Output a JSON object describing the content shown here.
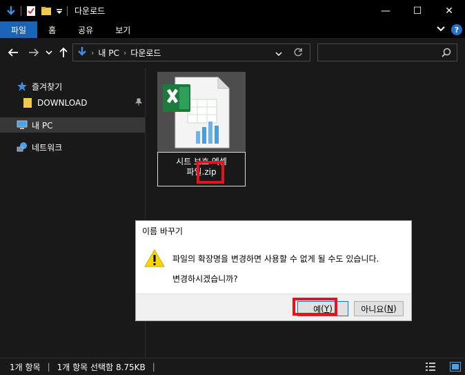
{
  "window": {
    "title": "다운로드",
    "minimize": "—",
    "maximize": "☐",
    "close": "✕"
  },
  "ribbon": {
    "tabs": [
      "파일",
      "홈",
      "공유",
      "보기"
    ],
    "expand": "⌄",
    "help": "?"
  },
  "address": {
    "crumbs": [
      "내 PC",
      "다운로드"
    ],
    "search_placeholder": ""
  },
  "navigation": {
    "items": [
      {
        "label": "즐겨찾기",
        "icon": "star-icon"
      },
      {
        "label": "DOWNLOAD",
        "icon": "folder-icon",
        "pinned": true
      },
      {
        "label": "내 PC",
        "icon": "computer-icon",
        "selected": true
      },
      {
        "label": "네트워크",
        "icon": "network-icon"
      }
    ]
  },
  "file": {
    "rename_line1": "시트 보호 엑셀",
    "rename_line2_prefix": "파일",
    "rename_line2_ext": ".zip",
    "icon": "excel-file-icon"
  },
  "dialog": {
    "title": "이름 바꾸기",
    "message1": "파일의 확장명을 변경하면 사용할 수 없게 될 수도 있습니다.",
    "message2": "변경하시겠습니까?",
    "yes_label": "예",
    "yes_key": "Y",
    "no_label": "아니요",
    "no_key": "N",
    "icon": "warning-icon"
  },
  "status": {
    "item_count": "1개 항목",
    "selection": "1개 항목 선택함 8.75KB"
  },
  "colors": {
    "accent": "#1a63b8",
    "highlight_red": "#e8121c",
    "background": "#191919"
  }
}
